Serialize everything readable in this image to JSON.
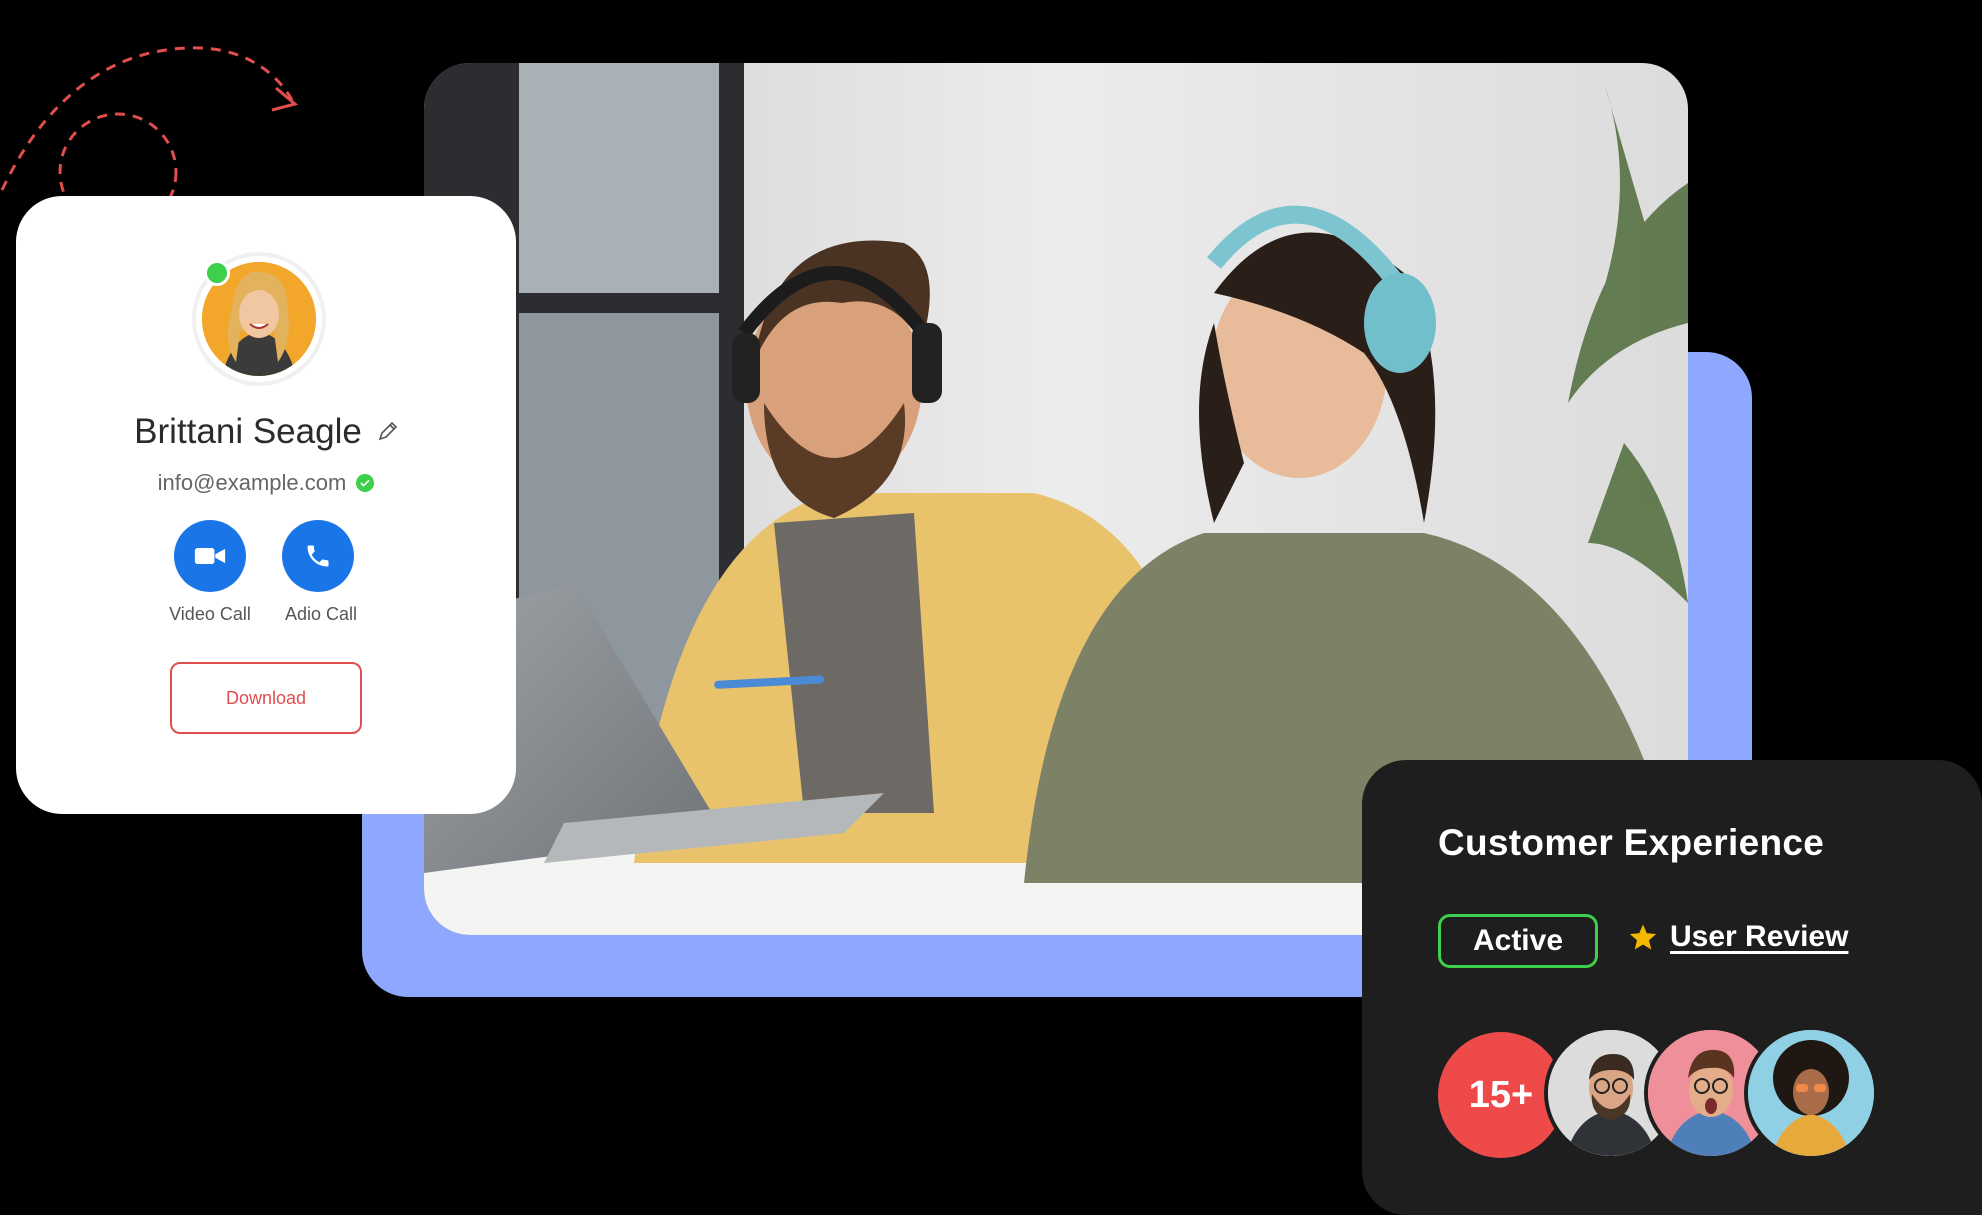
{
  "profile": {
    "name": "Brittani Seagle",
    "email": "info@example.com",
    "actions": [
      {
        "label": "Video Call",
        "icon": "video-camera-icon"
      },
      {
        "label": "Adio Call",
        "icon": "phone-icon"
      }
    ],
    "download_label": "Download",
    "status": "online"
  },
  "experience": {
    "title": "Customer Experience",
    "status_badge": "Active",
    "review_link": "User Review",
    "review_icon": "star-icon",
    "user_count": "15+"
  },
  "colors": {
    "accent_blue": "#1a76e8",
    "backdrop_blue": "#8ea8ff",
    "online_green": "#3ecf4c",
    "danger_red": "#e04e4e",
    "star_yellow": "#f5b800",
    "card_dark": "#1e1e1e"
  }
}
